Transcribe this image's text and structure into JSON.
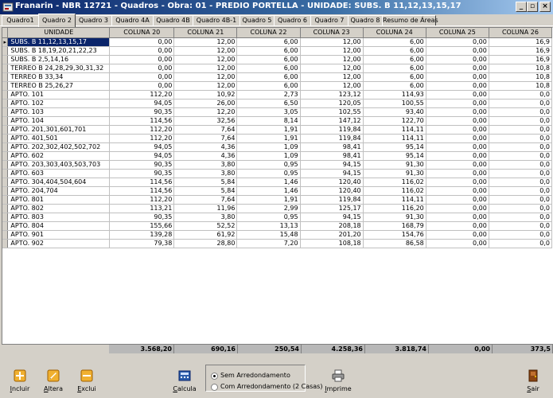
{
  "window": {
    "title": "Franarin - NBR 12721 - Quadros - Obra: 01 - PREDIO PORTELLA - UNIDADE: SUBS. B 11,12,13,15,17"
  },
  "tabs": [
    "Quadro1",
    "Quadro 2",
    "Quadro 3",
    "Quadro 4A",
    "Quadro 4B",
    "Quadro 4B-1",
    "Quadro 5",
    "Quadro 6",
    "Quadro 7",
    "Quadro 8",
    "Resumo de Áreas"
  ],
  "active_tab": "Quadro 2",
  "grid": {
    "columns": [
      "UNIDADE",
      "COLUNA 20",
      "COLUNA 21",
      "COLUNA 22",
      "COLUNA 23",
      "COLUNA 24",
      "COLUNA 25",
      "COLUNA 26"
    ],
    "rows": [
      [
        "SUBS. B 11,12,13,15,17",
        "0,00",
        "12,00",
        "6,00",
        "12,00",
        "6,00",
        "0,00",
        "16,9"
      ],
      [
        "SUBS. B 18,19,20,21,22,23",
        "0,00",
        "12,00",
        "6,00",
        "12,00",
        "6,00",
        "0,00",
        "16,9"
      ],
      [
        "SUBS. B 2,5,14,16",
        "0,00",
        "12,00",
        "6,00",
        "12,00",
        "6,00",
        "0,00",
        "16,9"
      ],
      [
        "TERREO B 24,28,29,30,31,32",
        "0,00",
        "12,00",
        "6,00",
        "12,00",
        "6,00",
        "0,00",
        "10,8"
      ],
      [
        "TERREO B 33,34",
        "0,00",
        "12,00",
        "6,00",
        "12,00",
        "6,00",
        "0,00",
        "10,8"
      ],
      [
        "TERREO B 25,26,27",
        "0,00",
        "12,00",
        "6,00",
        "12,00",
        "6,00",
        "0,00",
        "10,8"
      ],
      [
        "APTO. 101",
        "112,20",
        "10,92",
        "2,73",
        "123,12",
        "114,93",
        "0,00",
        "0,0"
      ],
      [
        "APTO. 102",
        "94,05",
        "26,00",
        "6,50",
        "120,05",
        "100,55",
        "0,00",
        "0,0"
      ],
      [
        "APTO. 103",
        "90,35",
        "12,20",
        "3,05",
        "102,55",
        "93,40",
        "0,00",
        "0,0"
      ],
      [
        "APTO. 104",
        "114,56",
        "32,56",
        "8,14",
        "147,12",
        "122,70",
        "0,00",
        "0,0"
      ],
      [
        "APTO. 201,301,601,701",
        "112,20",
        "7,64",
        "1,91",
        "119,84",
        "114,11",
        "0,00",
        "0,0"
      ],
      [
        "APTO. 401,501",
        "112,20",
        "7,64",
        "1,91",
        "119,84",
        "114,11",
        "0,00",
        "0,0"
      ],
      [
        "APTO. 202,302,402,502,702",
        "94,05",
        "4,36",
        "1,09",
        "98,41",
        "95,14",
        "0,00",
        "0,0"
      ],
      [
        "APTO. 602",
        "94,05",
        "4,36",
        "1,09",
        "98,41",
        "95,14",
        "0,00",
        "0,0"
      ],
      [
        "APTO. 203,303,403,503,703",
        "90,35",
        "3,80",
        "0,95",
        "94,15",
        "91,30",
        "0,00",
        "0,0"
      ],
      [
        "APTO. 603",
        "90,35",
        "3,80",
        "0,95",
        "94,15",
        "91,30",
        "0,00",
        "0,0"
      ],
      [
        "APTO. 304,404,504,604",
        "114,56",
        "5,84",
        "1,46",
        "120,40",
        "116,02",
        "0,00",
        "0,0"
      ],
      [
        "APTO. 204,704",
        "114,56",
        "5,84",
        "1,46",
        "120,40",
        "116,02",
        "0,00",
        "0,0"
      ],
      [
        "APTO. 801",
        "112,20",
        "7,64",
        "1,91",
        "119,84",
        "114,11",
        "0,00",
        "0,0"
      ],
      [
        "APTO. 802",
        "113,21",
        "11,96",
        "2,99",
        "125,17",
        "116,20",
        "0,00",
        "0,0"
      ],
      [
        "APTO. 803",
        "90,35",
        "3,80",
        "0,95",
        "94,15",
        "91,30",
        "0,00",
        "0,0"
      ],
      [
        "APTO. 804",
        "155,66",
        "52,52",
        "13,13",
        "208,18",
        "168,79",
        "0,00",
        "0,0"
      ],
      [
        "APTO. 901",
        "139,28",
        "61,92",
        "15,48",
        "201,20",
        "154,76",
        "0,00",
        "0,0"
      ],
      [
        "APTO. 902",
        "79,38",
        "28,80",
        "7,20",
        "108,18",
        "86,58",
        "0,00",
        "0,0"
      ]
    ],
    "totals": [
      "3.568,20",
      "690,16",
      "250,54",
      "4.258,36",
      "3.818,74",
      "0,00",
      "373,5"
    ]
  },
  "toolbar": {
    "incluir": "Incluir",
    "altera": "Altera",
    "exclui": "Exclui",
    "calcula": "Calcula",
    "imprime": "Imprime",
    "sair": "Sair",
    "radio_sem": "Sem Arredondamento",
    "radio_com": "Com Arredondamento (2 Casas)",
    "radio_selected": "Sem Arredondamento"
  },
  "colors": {
    "title_bar": "#0a246a",
    "selection": "#0a246a",
    "totals_bg": "#b8b8b8"
  }
}
